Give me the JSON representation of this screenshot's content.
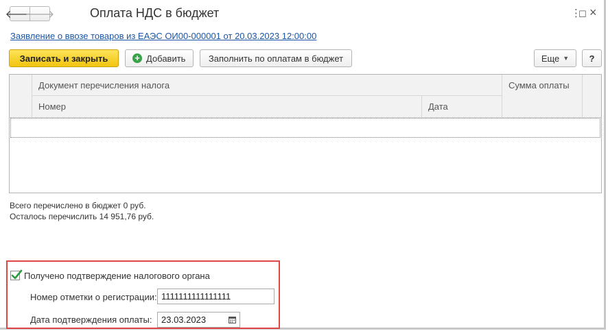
{
  "window": {
    "title": "Оплата НДС в бюджет",
    "nav_back": "🡐",
    "nav_forward": "🡒",
    "menu_icon": "⋮",
    "maximize_icon": "☐",
    "close_icon": "×"
  },
  "link": {
    "text": "Заявление о ввозе товаров из ЕАЭС ОИ00-000001 от 20.03.2023 12:00:00"
  },
  "toolbar": {
    "save_close_label": "Записать и закрыть",
    "add_label": "Добавить",
    "fill_label": "Заполнить по оплатам в бюджет",
    "more_label": "Еще",
    "help_label": "?"
  },
  "table": {
    "group_header": "Документ перечисления налога",
    "col_number": "Номер",
    "col_date": "Дата",
    "col_sum": "Сумма оплаты"
  },
  "summary": {
    "paid": "Всего перечислено в бюджет 0 руб.",
    "remaining": "Осталось перечислить 14 951,76 руб."
  },
  "confirmation": {
    "checkbox_label": "Получено подтверждение налогового органа",
    "checked": true,
    "reg_label": "Номер отметки о регистрации:",
    "reg_value": "1111111111111111",
    "date_label": "Дата подтверждения оплаты:",
    "date_value": "23.03.2023"
  },
  "colors": {
    "accent_yellow": "#f1c40f",
    "link_blue": "#1a55a6",
    "highlight_red": "#e04848",
    "check_green": "#2e9a3e"
  }
}
